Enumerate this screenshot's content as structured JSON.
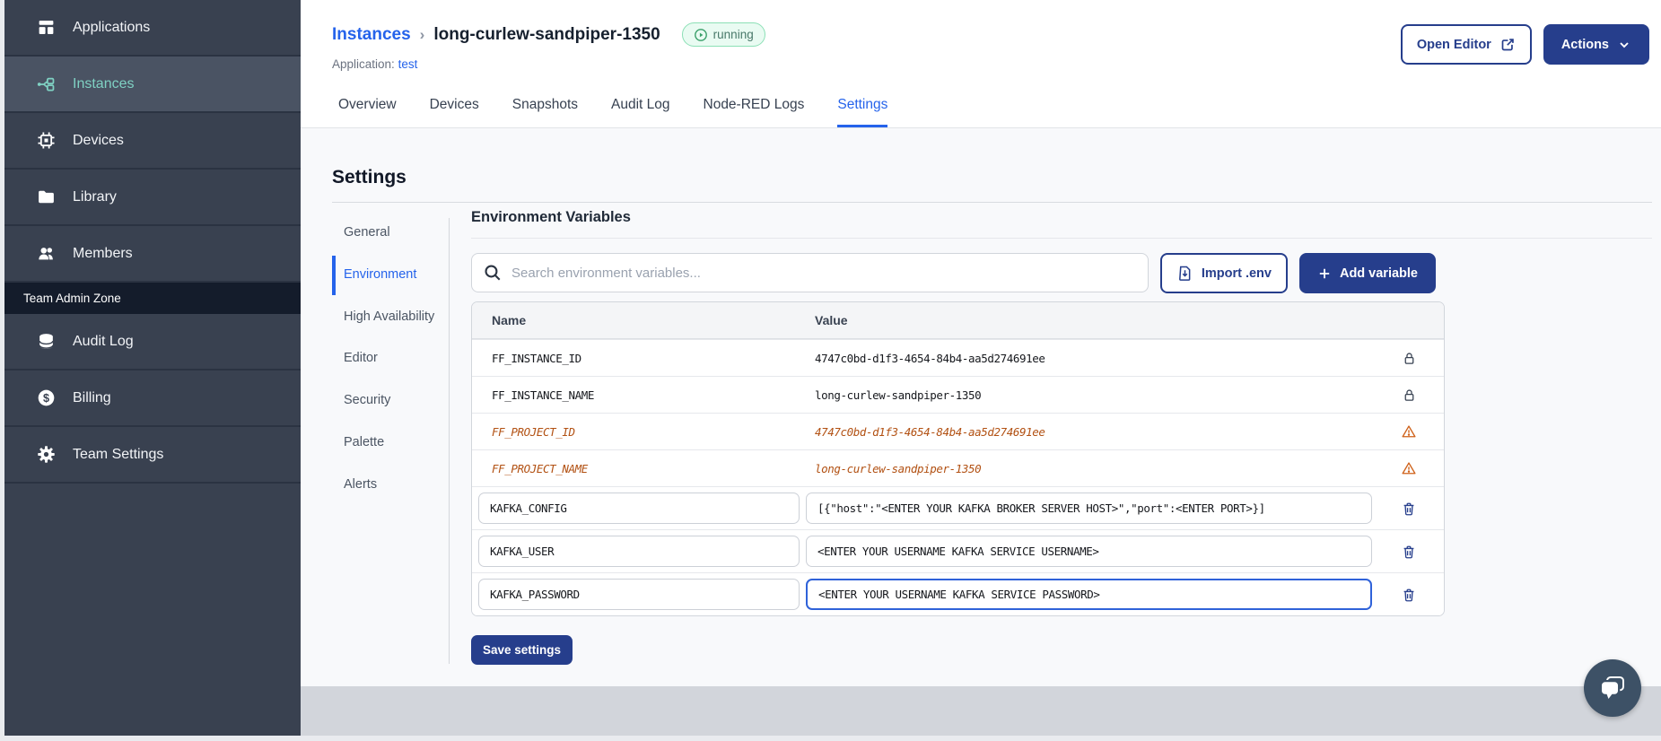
{
  "colors": {
    "navy": "#263e8c",
    "link_blue": "#2563eb",
    "sidebar_bg": "#394150",
    "sidebar_active_bg": "#4a5363",
    "teal_active": "#7fd1c3",
    "deprecated_orange": "#b25113",
    "badge_green_border": "#8ce0b6",
    "badge_green_bg": "#e9fbf2",
    "footer_gray": "#d2d5db"
  },
  "sidebar": {
    "items": [
      {
        "label": "Applications",
        "icon": "applications-icon"
      },
      {
        "label": "Instances",
        "icon": "instances-icon"
      },
      {
        "label": "Devices",
        "icon": "devices-icon"
      },
      {
        "label": "Library",
        "icon": "library-icon"
      },
      {
        "label": "Members",
        "icon": "members-icon"
      }
    ],
    "section_label": "Team Admin Zone",
    "admin_items": [
      {
        "label": "Audit Log",
        "icon": "audit-log-icon"
      },
      {
        "label": "Billing",
        "icon": "billing-icon"
      },
      {
        "label": "Team Settings",
        "icon": "team-settings-icon"
      }
    ]
  },
  "header": {
    "breadcrumb_parent": "Instances",
    "breadcrumb_separator": "›",
    "instance_name": "long-curlew-sandpiper-1350",
    "status_badge": "running",
    "application_label": "Application:",
    "application_name": "test",
    "open_editor_label": "Open Editor",
    "actions_label": "Actions"
  },
  "tabs": [
    {
      "label": "Overview"
    },
    {
      "label": "Devices"
    },
    {
      "label": "Snapshots"
    },
    {
      "label": "Audit Log"
    },
    {
      "label": "Node-RED Logs"
    },
    {
      "label": "Settings",
      "active": true
    }
  ],
  "settings": {
    "title": "Settings",
    "nav": [
      {
        "label": "General"
      },
      {
        "label": "Environment",
        "active": true
      },
      {
        "label": "High Availability"
      },
      {
        "label": "Editor"
      },
      {
        "label": "Security"
      },
      {
        "label": "Palette"
      },
      {
        "label": "Alerts"
      }
    ]
  },
  "env_panel": {
    "title": "Environment Variables",
    "search_placeholder": "Search environment variables...",
    "import_button": "Import .env",
    "add_button": "Add variable",
    "save_button": "Save settings",
    "table": {
      "columns": {
        "name": "Name",
        "value": "Value"
      },
      "rows": [
        {
          "name": "FF_INSTANCE_ID",
          "value": "4747c0bd-d1f3-4654-84b4-aa5d274691ee",
          "type": "locked"
        },
        {
          "name": "FF_INSTANCE_NAME",
          "value": "long-curlew-sandpiper-1350",
          "type": "locked"
        },
        {
          "name": "FF_PROJECT_ID",
          "value": "4747c0bd-d1f3-4654-84b4-aa5d274691ee",
          "type": "deprecated"
        },
        {
          "name": "FF_PROJECT_NAME",
          "value": "long-curlew-sandpiper-1350",
          "type": "deprecated"
        },
        {
          "name": "KAFKA_CONFIG",
          "value": "[{\"host\":\"<ENTER YOUR KAFKA BROKER SERVER HOST>\",\"port\":<ENTER PORT>}]",
          "type": "editable"
        },
        {
          "name": "KAFKA_USER",
          "value": "<ENTER YOUR USERNAME KAFKA SERVICE USERNAME>",
          "type": "editable"
        },
        {
          "name": "KAFKA_PASSWORD",
          "value": "<ENTER YOUR USERNAME KAFKA SERVICE PASSWORD>",
          "type": "editable",
          "focused": true
        }
      ]
    }
  }
}
